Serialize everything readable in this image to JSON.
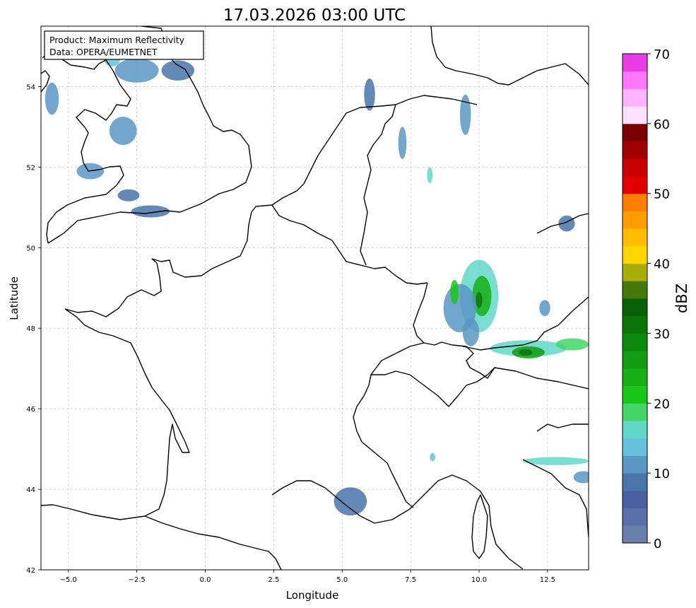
{
  "title": "17.03.2026 03:00 UTC",
  "info_box": {
    "line1": "Product: Maximum Reflectivity",
    "line2": "Data: OPERA/EUMETNET"
  },
  "xlabel": "Longitude",
  "ylabel": "Latitude",
  "x_ticks": [
    "−5.0",
    "−2.5",
    "0.0",
    "2.5",
    "5.0",
    "7.5",
    "10.0",
    "12.5"
  ],
  "x_tick_values": [
    -5.0,
    -2.5,
    0.0,
    2.5,
    5.0,
    7.5,
    10.0,
    12.5
  ],
  "y_ticks": [
    "42",
    "44",
    "46",
    "48",
    "50",
    "52",
    "54"
  ],
  "y_tick_values": [
    42,
    44,
    46,
    48,
    50,
    52,
    54
  ],
  "xlim": [
    -6,
    14
  ],
  "ylim": [
    42,
    55.5
  ],
  "colorbar": {
    "label": "dBZ",
    "ticks": [
      "0",
      "10",
      "20",
      "30",
      "40",
      "50",
      "60",
      "70"
    ],
    "tick_values": [
      0,
      10,
      20,
      30,
      40,
      50,
      60,
      70
    ],
    "range": [
      0,
      70
    ],
    "step": 2.5,
    "colors": [
      "#6a7fae",
      "#5a6eaa",
      "#4a60a3",
      "#4a74aa",
      "#5a97c4",
      "#66bfdc",
      "#62d7c8",
      "#44d56a",
      "#1ac61a",
      "#16b016",
      "#119c11",
      "#0d8a0d",
      "#0a760a",
      "#075f07",
      "#447a0a",
      "#a9ad0a",
      "#ffd700",
      "#ffbd00",
      "#ff9d00",
      "#ff7d00",
      "#e00000",
      "#c80000",
      "#a00000",
      "#7a0000",
      "#ffe0ff",
      "#ffb3ff",
      "#ff77ff",
      "#e83ee8"
    ]
  },
  "rain_cells": [
    {
      "lon": 10.0,
      "lat": 48.8,
      "level": 15,
      "rx": 0.7,
      "ry": 0.9
    },
    {
      "lon": 10.1,
      "lat": 48.8,
      "level": 24,
      "rx": 0.35,
      "ry": 0.5
    },
    {
      "lon": 10.0,
      "lat": 48.7,
      "level": 32,
      "rx": 0.12,
      "ry": 0.2
    },
    {
      "lon": 9.3,
      "lat": 48.5,
      "level": 12,
      "rx": 0.6,
      "ry": 0.6
    },
    {
      "lon": 9.1,
      "lat": 48.9,
      "level": 20,
      "rx": 0.15,
      "ry": 0.3
    },
    {
      "lon": 9.7,
      "lat": 47.9,
      "level": 12,
      "rx": 0.3,
      "ry": 0.35
    },
    {
      "lon": 11.8,
      "lat": 47.5,
      "level": 15,
      "rx": 1.4,
      "ry": 0.2
    },
    {
      "lon": 11.8,
      "lat": 47.4,
      "level": 26,
      "rx": 0.6,
      "ry": 0.15
    },
    {
      "lon": 11.7,
      "lat": 47.4,
      "level": 30,
      "rx": 0.25,
      "ry": 0.08
    },
    {
      "lon": 13.4,
      "lat": 47.6,
      "level": 18,
      "rx": 0.6,
      "ry": 0.15
    },
    {
      "lon": 12.4,
      "lat": 48.5,
      "level": 10,
      "rx": 0.2,
      "ry": 0.2
    },
    {
      "lon": -3.0,
      "lat": 52.9,
      "level": 10,
      "rx": 0.5,
      "ry": 0.35
    },
    {
      "lon": -2.5,
      "lat": 54.4,
      "level": 10,
      "rx": 0.8,
      "ry": 0.3
    },
    {
      "lon": -1.0,
      "lat": 54.4,
      "level": 9,
      "rx": 0.6,
      "ry": 0.25
    },
    {
      "lon": -3.4,
      "lat": 54.7,
      "level": 14,
      "rx": 0.3,
      "ry": 0.2
    },
    {
      "lon": -4.2,
      "lat": 51.9,
      "level": 12,
      "rx": 0.5,
      "ry": 0.2
    },
    {
      "lon": -2.8,
      "lat": 51.3,
      "level": 8,
      "rx": 0.4,
      "ry": 0.15
    },
    {
      "lon": -5.6,
      "lat": 53.7,
      "level": 10,
      "rx": 0.25,
      "ry": 0.4
    },
    {
      "lon": -2.0,
      "lat": 50.9,
      "level": 9,
      "rx": 0.7,
      "ry": 0.15
    },
    {
      "lon": 9.5,
      "lat": 53.3,
      "level": 10,
      "rx": 0.2,
      "ry": 0.5
    },
    {
      "lon": 6.0,
      "lat": 53.8,
      "level": 9,
      "rx": 0.2,
      "ry": 0.4
    },
    {
      "lon": 7.2,
      "lat": 52.6,
      "level": 10,
      "rx": 0.15,
      "ry": 0.4
    },
    {
      "lon": 8.2,
      "lat": 51.8,
      "level": 17,
      "rx": 0.1,
      "ry": 0.2
    },
    {
      "lon": 13.2,
      "lat": 50.6,
      "level": 9,
      "rx": 0.3,
      "ry": 0.2
    },
    {
      "lon": 12.8,
      "lat": 44.7,
      "level": 15,
      "rx": 1.2,
      "ry": 0.1
    },
    {
      "lon": 13.8,
      "lat": 44.3,
      "level": 10,
      "rx": 0.35,
      "ry": 0.15
    },
    {
      "lon": 5.3,
      "lat": 43.7,
      "level": 8,
      "rx": 0.6,
      "ry": 0.35
    },
    {
      "lon": 8.3,
      "lat": 44.8,
      "level": 14,
      "rx": 0.1,
      "ry": 0.1
    }
  ]
}
